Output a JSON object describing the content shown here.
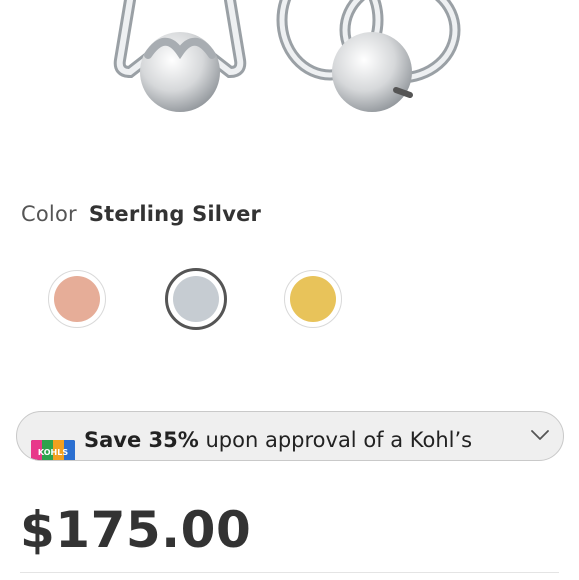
{
  "color": {
    "label": "Color",
    "selected": "Sterling Silver"
  },
  "swatches": [
    {
      "name": "rose",
      "hex": "#e6ad98"
    },
    {
      "name": "silver",
      "hex": "#c6ccd2"
    },
    {
      "name": "gold",
      "hex": "#e8c35a"
    }
  ],
  "promo": {
    "bold": "Save 35%",
    "text": " upon approval of a Kohl’s Card",
    "suffix": "*",
    "card_logo_text": "KOHLS",
    "chevron_icon": "chevron-down-icon"
  },
  "price": "$175.00"
}
